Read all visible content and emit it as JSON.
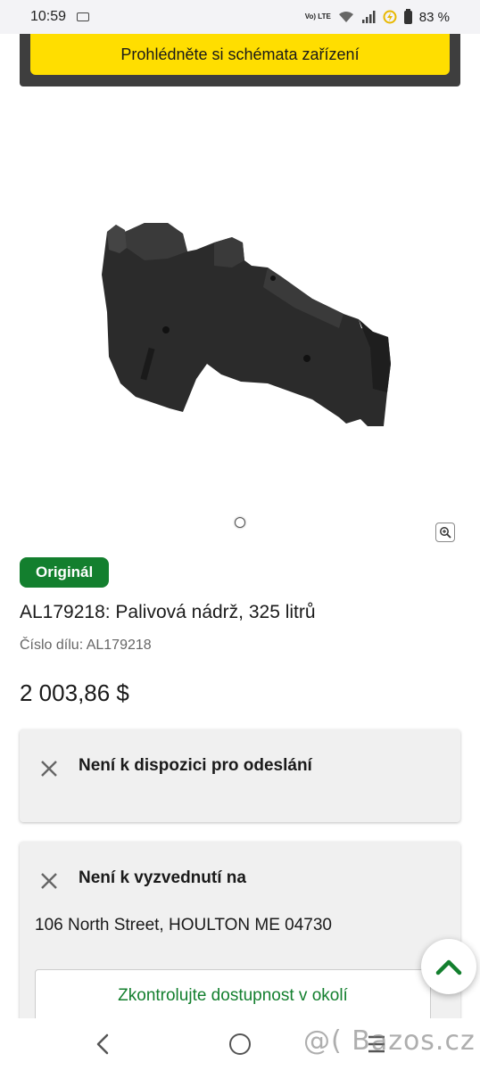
{
  "status_bar": {
    "time": "10:59",
    "network_badge": "Vo) LTE",
    "battery": "83 %"
  },
  "banner": {
    "label": "Prohlédněte si schémata zařízení",
    "color": "#ffde00"
  },
  "product": {
    "badge": "Originál",
    "title": "AL179218: Palivová nádrž, 325 litrů",
    "part_number_label": "Číslo dílu: AL179218",
    "price": "2 003,86 $"
  },
  "availability": {
    "shipping_label": "Není k dispozici pro odeslání",
    "pickup_label": "Není k vyzvednutí na",
    "address": "106 North Street, HOULTON ME 04730",
    "check_button": "Zkontrolujte dostupnost v okolí"
  },
  "watermark": "@( Bazos.cz",
  "colors": {
    "accent_green": "#137f2e",
    "banner_yellow": "#ffde00"
  },
  "icons": [
    "gmail-icon",
    "wifi-icon",
    "signal-icon",
    "data-saver-icon",
    "battery-icon",
    "zoom-icon",
    "close-icon",
    "chevron-up-icon",
    "back-icon",
    "home-icon",
    "recents-icon"
  ]
}
